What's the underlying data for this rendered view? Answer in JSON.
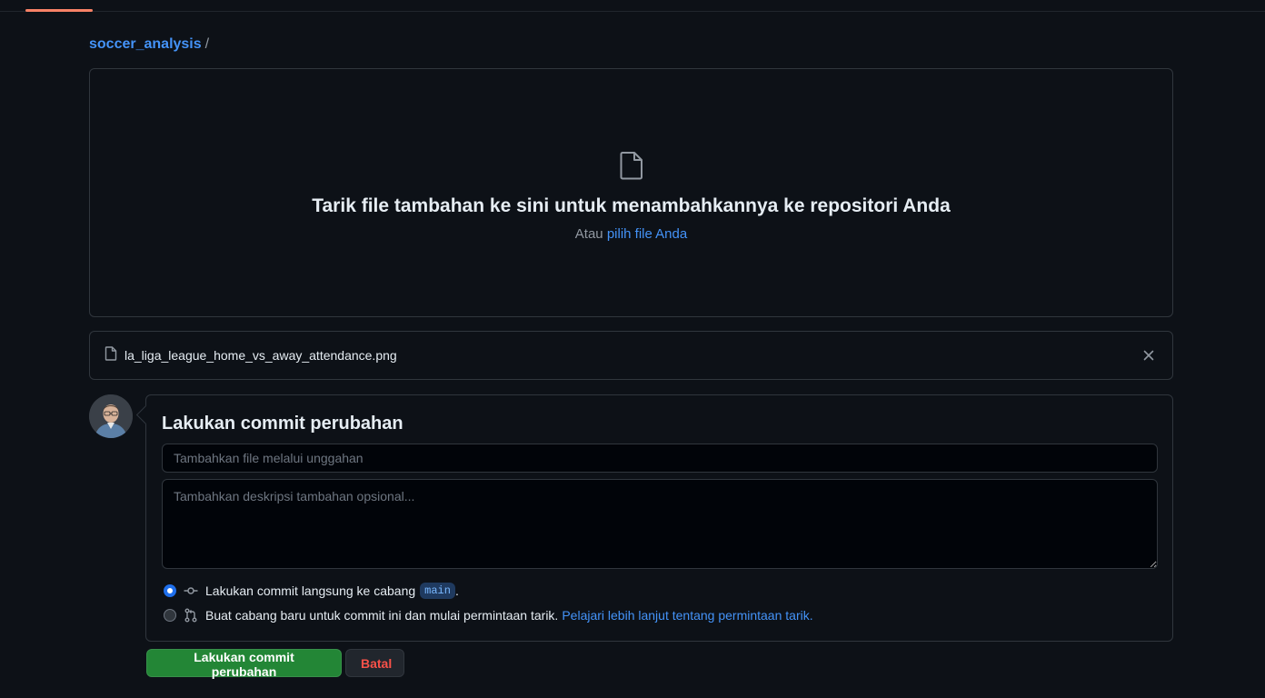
{
  "breadcrumb": {
    "repo": "soccer_analysis",
    "separator": "/"
  },
  "dropzone": {
    "icon": "file-icon",
    "title": "Tarik file tambahan ke sini untuk menambahkannya ke repositori Anda",
    "subtitle_prefix": "Atau",
    "choose_link": "pilih file Anda"
  },
  "uploaded_file": {
    "icon": "file-icon",
    "name": "la_liga_league_home_vs_away_attendance.png",
    "remove_icon": "close-icon"
  },
  "commit": {
    "heading": "Lakukan commit perubahan",
    "summary_placeholder": "Tambahkan file melalui unggahan",
    "summary_value": "",
    "description_placeholder": "Tambahkan deskripsi tambahan opsional...",
    "description_value": "",
    "option_direct": {
      "label": "Lakukan commit langsung ke cabang",
      "branch": "main",
      "suffix": ".",
      "icon": "git-commit-icon",
      "selected": true
    },
    "option_new_branch": {
      "label": "Buat cabang baru untuk commit ini dan mulai permintaan tarik.",
      "link": "Pelajari lebih lanjut tentang permintaan tarik.",
      "icon": "git-pull-request-icon",
      "selected": false
    }
  },
  "buttons": {
    "commit": "Lakukan commit perubahan",
    "cancel": "Batal"
  },
  "colors": {
    "background": "#0d1117",
    "link": "#4493f8",
    "primary_button": "#238636",
    "danger_text": "#f85149",
    "border": "#30363d",
    "active_tab_underline": "#f78166"
  }
}
